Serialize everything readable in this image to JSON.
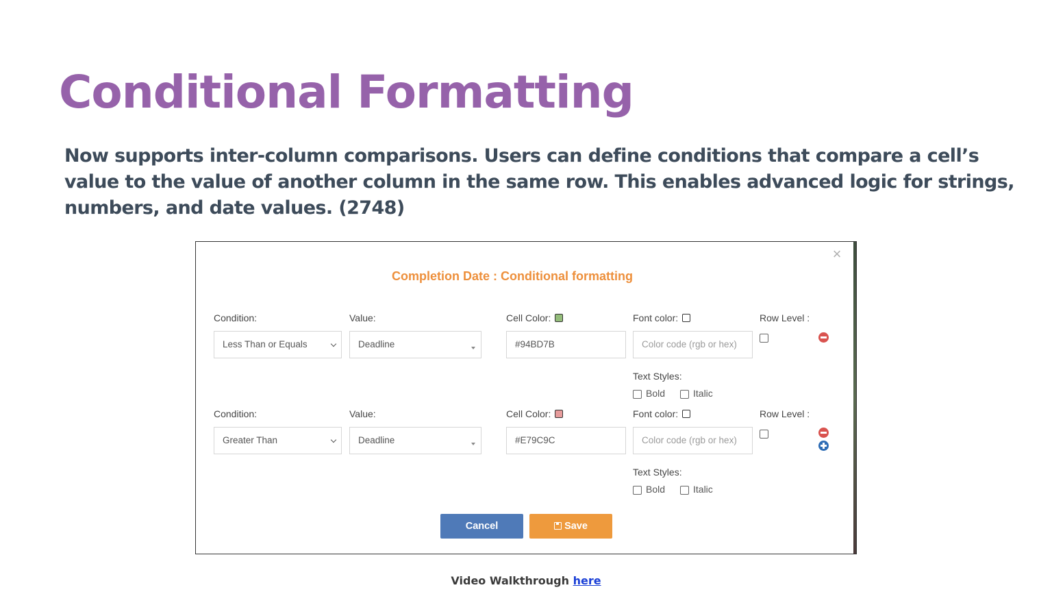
{
  "slide": {
    "title": "Conditional Formatting",
    "description": "Now supports inter-column comparisons. Users can define conditions that compare a cell’s value to the value of another column in the same row. This enables advanced logic for strings, numbers, and date values. (2748)"
  },
  "modal": {
    "title": "Completion Date : Conditional formatting",
    "close_glyph": "×",
    "labels": {
      "condition": "Condition:",
      "value": "Value:",
      "cell_color": "Cell Color:",
      "font_color": "Font color:",
      "row_level": "Row Level :",
      "text_styles": "Text Styles:",
      "bold": "Bold",
      "italic": "Italic"
    },
    "rules": [
      {
        "condition": "Less Than or Equals",
        "value": "Deadline",
        "cell_color": "#94BD7B",
        "swatch_color": "#94bd7b",
        "font_color_placeholder": "Color code (rgb or hex)"
      },
      {
        "condition": "Greater Than",
        "value": "Deadline",
        "cell_color": "#E79C9C",
        "swatch_color": "#e79c9c",
        "font_color_placeholder": "Color code (rgb or hex)"
      }
    ],
    "buttons": {
      "cancel": "Cancel",
      "save": "Save"
    }
  },
  "footer": {
    "text": "Video Walkthrough ",
    "link": "here"
  }
}
